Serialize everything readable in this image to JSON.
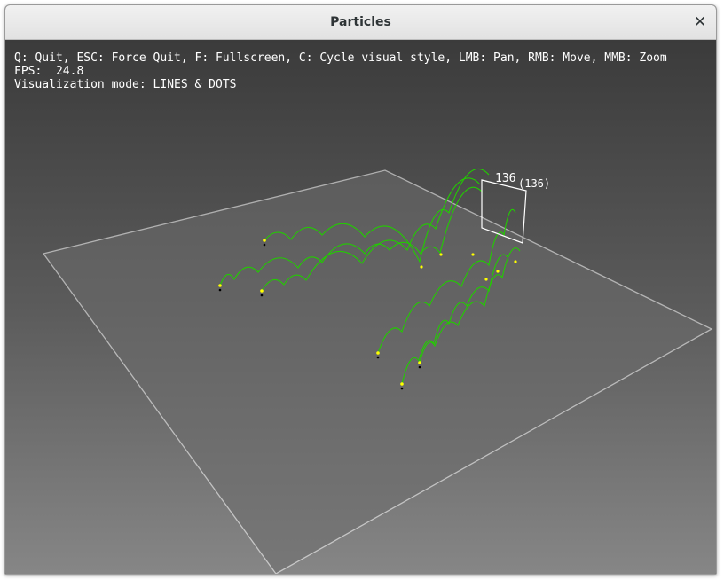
{
  "window": {
    "title": "Particles"
  },
  "hud": {
    "controls": "Q: Quit, ESC: Force Quit, F: Fullscreen, C: Cycle visual style, LMB: Pan, RMB: Move, MMB: Zoom",
    "fps_label": "FPS:",
    "fps_value": "24.8",
    "mode_label": "Visualization mode:",
    "mode_value": "LINES & DOTS"
  },
  "scene": {
    "particle_count": "136",
    "particle_count_paren": "(136)",
    "trail_color": "#22cc00",
    "dot_color": "#ffff00",
    "shadow_color": "#000000",
    "floor_color": "#6c6c6c",
    "outline_color": "#ffffff"
  }
}
